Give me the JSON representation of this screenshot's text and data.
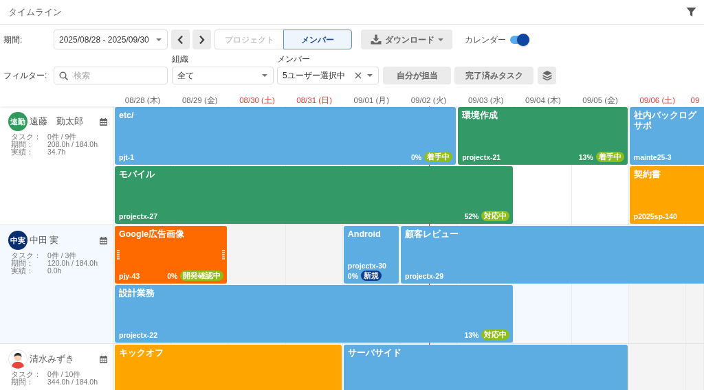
{
  "header": {
    "title": "タイムライン"
  },
  "toolbar": {
    "period": {
      "label": "期間:",
      "value": "2025/08/28 - 2025/09/30"
    },
    "view_tabs": [
      {
        "label": "プロジェクト",
        "selected": false
      },
      {
        "label": "メンバー",
        "selected": true
      }
    ],
    "download": {
      "label": "ダウンロード"
    },
    "calendar": {
      "label": "カレンダー",
      "on": true
    },
    "filter": {
      "label": "フィルター:",
      "search": {
        "placeholder": "検索"
      },
      "organization": {
        "label": "組織",
        "value": "全て"
      },
      "member": {
        "label": "メンバー",
        "value": "5ユーザー選択中"
      },
      "buttons": [
        "自分が担当",
        "完了済みタスク"
      ]
    }
  },
  "timeline": {
    "days": [
      {
        "label": "08/28 (木)",
        "holiday": false,
        "today": false
      },
      {
        "label": "08/29 (金)",
        "holiday": false,
        "today": false
      },
      {
        "label": "08/30 (土)",
        "holiday": true,
        "today": false
      },
      {
        "label": "08/31 (日)",
        "holiday": true,
        "today": false
      },
      {
        "label": "09/01 (月)",
        "holiday": false,
        "today": false
      },
      {
        "label": "09/02 (火)",
        "holiday": false,
        "today": true
      },
      {
        "label": "09/03 (水)",
        "holiday": false,
        "today": false
      },
      {
        "label": "09/04 (木)",
        "holiday": false,
        "today": false
      },
      {
        "label": "09/05 (金)",
        "holiday": false,
        "today": false
      },
      {
        "label": "09/06 (土)",
        "holiday": true,
        "today": false
      },
      {
        "label": "09",
        "holiday": true,
        "today": false
      }
    ],
    "members": [
      {
        "name": "遠藤　勤太郎",
        "avatar": {
          "kind": "initials",
          "text": "遠勤",
          "color": "#2f9a5c"
        },
        "stats": [
          {
            "label": "タスク：",
            "value": "0件 / 9件"
          },
          {
            "label": "期間：",
            "value": "208.0h / 184.0h"
          },
          {
            "label": "実績：",
            "value": "34.7h"
          }
        ],
        "lanes": [
          [
            {
              "kind": "task",
              "title": "etc/",
              "code": "pjt-1",
              "color": "#5dace2",
              "progress": "0%",
              "status": {
                "label": "着手中",
                "color": "#8fbd1c"
              },
              "hovered": false
            },
            {
              "kind": "more"
            },
            {
              "kind": "more"
            },
            {
              "kind": "more"
            },
            {
              "kind": "more"
            },
            {
              "kind": "more"
            },
            {
              "kind": "task",
              "title": "環境作成",
              "code": "projectx-21",
              "color": "#339966",
              "progress": "13%",
              "status": {
                "label": "着手中",
                "color": "#8fbd1c"
              },
              "hovered": false
            },
            {
              "kind": "more"
            },
            {
              "kind": "more"
            },
            {
              "kind": "task",
              "title": "社内バックログサポ",
              "code": "mainte25-3",
              "color": "#5dace2",
              "hovered": false
            },
            {
              "kind": "more"
            }
          ],
          [
            {
              "kind": "task",
              "title": "モバイル",
              "code": "projectx-27",
              "color": "#339966",
              "progress": "52%",
              "status": {
                "label": "対応中",
                "color": "#8fbd1c"
              },
              "hovered": false
            },
            {
              "kind": "more"
            },
            {
              "kind": "more"
            },
            {
              "kind": "more"
            },
            {
              "kind": "more"
            },
            {
              "kind": "more"
            },
            {
              "kind": "more"
            },
            {
              "kind": "free"
            },
            {
              "kind": "free"
            },
            {
              "kind": "task",
              "title": "契約書",
              "code": "p2025sp-140",
              "color": "#ffa500",
              "hovered": false
            },
            {
              "kind": "more"
            }
          ]
        ]
      },
      {
        "name": "中田 実",
        "avatar": {
          "kind": "initials",
          "text": "中実",
          "color": "#0b2e6e"
        },
        "stats": [
          {
            "label": "タスク：",
            "value": "0件 / 3件"
          },
          {
            "label": "期間：",
            "value": "120.0h / 184.0h"
          },
          {
            "label": "実績：",
            "value": "0.0h"
          }
        ],
        "lanes": [
          [
            {
              "kind": "task",
              "title": "Google広告画像",
              "code": "pjy-43",
              "color": "#ff6a00",
              "progress": "0%",
              "status": {
                "label": "開発確認中",
                "color": "#8fbd1c"
              },
              "hovered": true
            },
            {
              "kind": "more"
            },
            {
              "kind": "free"
            },
            {
              "kind": "free"
            },
            {
              "kind": "task",
              "title": "Android",
              "code": "projectx-30",
              "color": "#5dace2",
              "progress": "0%",
              "status": {
                "label": "新規",
                "color": "#0d3b8e"
              },
              "hovered": false
            },
            {
              "kind": "task",
              "title": "顧客レビュー",
              "code": "projectx-29",
              "color": "#5dace2",
              "hovered": false
            },
            {
              "kind": "more"
            },
            {
              "kind": "more"
            },
            {
              "kind": "more"
            },
            {
              "kind": "more"
            },
            {
              "kind": "more"
            }
          ],
          [
            {
              "kind": "task",
              "title": "設計業務",
              "code": "projectx-22",
              "color": "#5dace2",
              "progress": "13%",
              "status": {
                "label": "対応中",
                "color": "#8fbd1c"
              },
              "hovered": false
            },
            {
              "kind": "more"
            },
            {
              "kind": "more"
            },
            {
              "kind": "more"
            },
            {
              "kind": "more"
            },
            {
              "kind": "more"
            },
            {
              "kind": "more"
            },
            {
              "kind": "free"
            },
            {
              "kind": "free"
            },
            {
              "kind": "free"
            },
            {
              "kind": "free"
            }
          ]
        ]
      },
      {
        "name": "清水みずき",
        "avatar": {
          "kind": "illustration"
        },
        "stats": [
          {
            "label": "タスク：",
            "value": "0件 / 10件"
          },
          {
            "label": "期間：",
            "value": "344.0h / 184.0h"
          }
        ],
        "lanes": [
          [
            {
              "kind": "task",
              "title": "キックオフ",
              "color": "#ffa500",
              "hovered": false
            },
            {
              "kind": "more"
            },
            {
              "kind": "more"
            },
            {
              "kind": "more"
            },
            {
              "kind": "task",
              "title": "サーバサイド",
              "color": "#5dace2",
              "hovered": false
            },
            {
              "kind": "more"
            },
            {
              "kind": "more"
            },
            {
              "kind": "more"
            },
            {
              "kind": "more"
            },
            {
              "kind": "free"
            },
            {
              "kind": "free"
            }
          ]
        ]
      }
    ]
  }
}
